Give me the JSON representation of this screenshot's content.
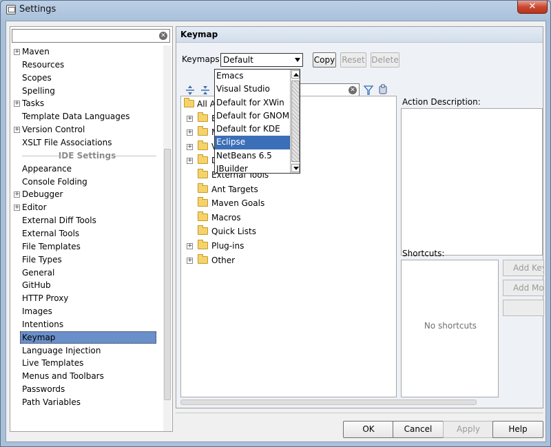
{
  "window": {
    "title": "Settings",
    "close_glyph": "✕"
  },
  "left": {
    "search_placeholder": "",
    "items_top": [
      {
        "label": "Maven",
        "expandable": true
      },
      {
        "label": "Resources",
        "expandable": false
      },
      {
        "label": "Scopes",
        "expandable": false
      },
      {
        "label": "Spelling",
        "expandable": false
      },
      {
        "label": "Tasks",
        "expandable": true
      },
      {
        "label": "Template Data Languages",
        "expandable": false
      },
      {
        "label": "Version Control",
        "expandable": true
      },
      {
        "label": "XSLT File Associations",
        "expandable": false
      }
    ],
    "ide_section": "IDE Settings",
    "items_ide": [
      {
        "label": "Appearance",
        "expandable": false
      },
      {
        "label": "Console Folding",
        "expandable": false
      },
      {
        "label": "Debugger",
        "expandable": true
      },
      {
        "label": "Editor",
        "expandable": true
      },
      {
        "label": "External Diff Tools",
        "expandable": false
      },
      {
        "label": "External Tools",
        "expandable": false
      },
      {
        "label": "File Templates",
        "expandable": false
      },
      {
        "label": "File Types",
        "expandable": false
      },
      {
        "label": "General",
        "expandable": false
      },
      {
        "label": "GitHub",
        "expandable": false
      },
      {
        "label": "HTTP Proxy",
        "expandable": false
      },
      {
        "label": "Images",
        "expandable": false
      },
      {
        "label": "Intentions",
        "expandable": false
      },
      {
        "label": "Keymap",
        "expandable": false,
        "selected": true
      },
      {
        "label": "Language Injection",
        "expandable": false
      },
      {
        "label": "Live Templates",
        "expandable": false
      },
      {
        "label": "Menus and Toolbars",
        "expandable": false
      },
      {
        "label": "Passwords",
        "expandable": false
      },
      {
        "label": "Path Variables",
        "expandable": false
      }
    ]
  },
  "right": {
    "header": "Keymap",
    "keymaps_label": "Keymaps",
    "keymaps_value": "Default",
    "copy_label": "Copy",
    "reset_label": "Reset",
    "delete_label": "Delete",
    "tree": [
      {
        "label": "All Act",
        "expandable": false,
        "indent": 0
      },
      {
        "label": "Ed",
        "expandable": true,
        "indent": 1
      },
      {
        "label": "Ma",
        "expandable": true,
        "indent": 1
      },
      {
        "label": "Ve",
        "expandable": true,
        "indent": 1
      },
      {
        "label": "De",
        "expandable": true,
        "indent": 1
      },
      {
        "label": "External Tools",
        "expandable": false,
        "indent": 1
      },
      {
        "label": "Ant Targets",
        "expandable": false,
        "indent": 1
      },
      {
        "label": "Maven Goals",
        "expandable": false,
        "indent": 1
      },
      {
        "label": "Macros",
        "expandable": false,
        "indent": 1
      },
      {
        "label": "Quick Lists",
        "expandable": false,
        "indent": 1
      },
      {
        "label": "Plug-ins",
        "expandable": true,
        "indent": 1
      },
      {
        "label": "Other",
        "expandable": true,
        "indent": 1
      }
    ],
    "action_description_label": "Action Description:",
    "shortcuts_label": "Shortcuts:",
    "no_shortcuts": "No shortcuts",
    "add_keyboard_label": "Add Key",
    "add_mouse_label": "Add Mo"
  },
  "dropdown": {
    "options": [
      "Emacs",
      "Visual Studio",
      "Default for XWin",
      "Default for GNOME",
      "Default for KDE",
      "Eclipse",
      "NetBeans 6.5",
      "JBuilder"
    ],
    "selected": "Eclipse"
  },
  "bottom": {
    "ok": "OK",
    "cancel": "Cancel",
    "apply": "Apply",
    "help": "Help"
  },
  "colors": {
    "selection": "#6a8fca",
    "dropdown_selection": "#3b6fb7",
    "window_frame": "#a9c0da"
  }
}
